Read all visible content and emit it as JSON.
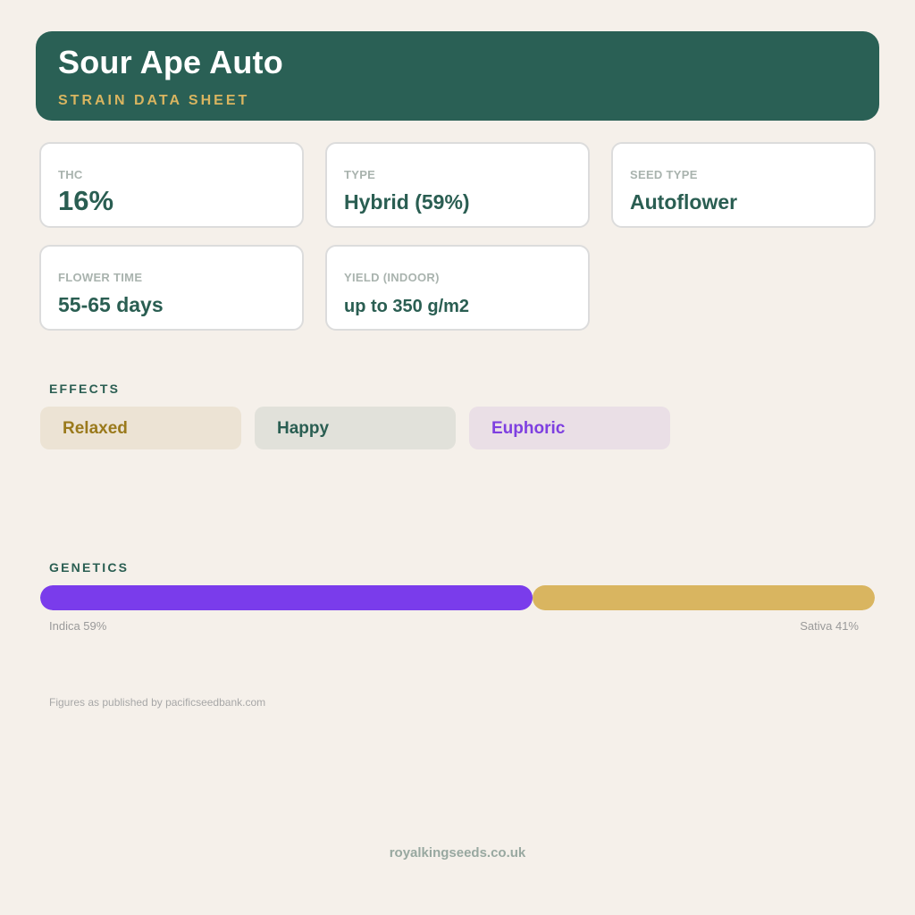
{
  "header": {
    "title": "Sour Ape Auto",
    "subtitle": "STRAIN DATA SHEET"
  },
  "stats": {
    "thc": {
      "label": "THC",
      "value": "16%"
    },
    "type": {
      "label": "TYPE",
      "value": "Hybrid (59%)"
    },
    "seed_type": {
      "label": "SEED TYPE",
      "value": "Autoflower"
    },
    "flower_time": {
      "label": "FLOWER TIME",
      "value": "55-65 days"
    },
    "yield": {
      "label": "YIELD (INDOOR)",
      "value": "up to 350 g/m2"
    }
  },
  "effects": {
    "label": "EFFECTS",
    "items": [
      {
        "label": "Relaxed",
        "bg": "#ece3d4",
        "color": "#9a7a1c"
      },
      {
        "label": "Happy",
        "bg": "#e1e1da",
        "color": "#2a5e52"
      },
      {
        "label": "Euphoric",
        "bg": "#eadfe6",
        "color": "#7e3fe0"
      }
    ]
  },
  "genetics": {
    "label": "GENETICS",
    "indica": {
      "label": "Indica 59%",
      "percent": 59,
      "color": "#7a3ceb"
    },
    "sativa": {
      "label": "Sativa 41%",
      "percent": 41,
      "color": "#d9b560"
    }
  },
  "source_note": "Figures as published by pacificseedbank.com",
  "footer": "royalkingseeds.co.uk",
  "colors": {
    "background": "#f5f0ea",
    "header": "#2a6055",
    "accent_gold": "#d9b560",
    "text_green": "#2a5e52"
  }
}
